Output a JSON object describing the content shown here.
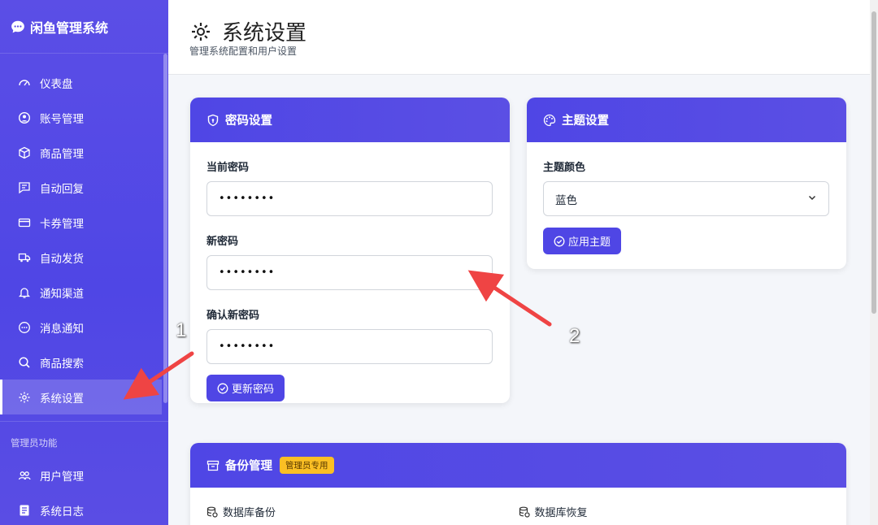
{
  "brand": {
    "name": "闲鱼管理系统"
  },
  "sidebar": {
    "items": [
      {
        "label": "仪表盘",
        "icon": "gauge-icon"
      },
      {
        "label": "账号管理",
        "icon": "user-circle-icon"
      },
      {
        "label": "商品管理",
        "icon": "box-icon"
      },
      {
        "label": "自动回复",
        "icon": "message-icon"
      },
      {
        "label": "卡券管理",
        "icon": "card-icon"
      },
      {
        "label": "自动发货",
        "icon": "truck-icon"
      },
      {
        "label": "通知渠道",
        "icon": "bell-icon"
      },
      {
        "label": "消息通知",
        "icon": "chat-dots-icon"
      },
      {
        "label": "商品搜索",
        "icon": "search-icon"
      },
      {
        "label": "系统设置",
        "icon": "gear-icon",
        "active": true
      }
    ],
    "admin_section": "管理员功能",
    "admin_items": [
      {
        "label": "用户管理",
        "icon": "users-icon"
      },
      {
        "label": "系统日志",
        "icon": "log-icon"
      }
    ]
  },
  "header": {
    "title": "系统设置",
    "subtitle": "管理系统配置和用户设置"
  },
  "password_card": {
    "title": "密码设置",
    "current_label": "当前密码",
    "current_value": "••••••••",
    "new_label": "新密码",
    "new_value": "••••••••",
    "confirm_label": "确认新密码",
    "confirm_value": "••••••••",
    "button": "更新密码"
  },
  "theme_card": {
    "title": "主题设置",
    "color_label": "主题颜色",
    "selected": "蓝色",
    "button": "应用主题"
  },
  "backup_card": {
    "title": "备份管理",
    "badge": "管理员专用",
    "backup_label": "数据库备份",
    "restore_label": "数据库恢复"
  },
  "annotations": {
    "one": "1",
    "two": "2"
  },
  "colors": {
    "primary": "#4f46e5",
    "badge": "#fbbf24",
    "arrow": "#ef4444"
  }
}
